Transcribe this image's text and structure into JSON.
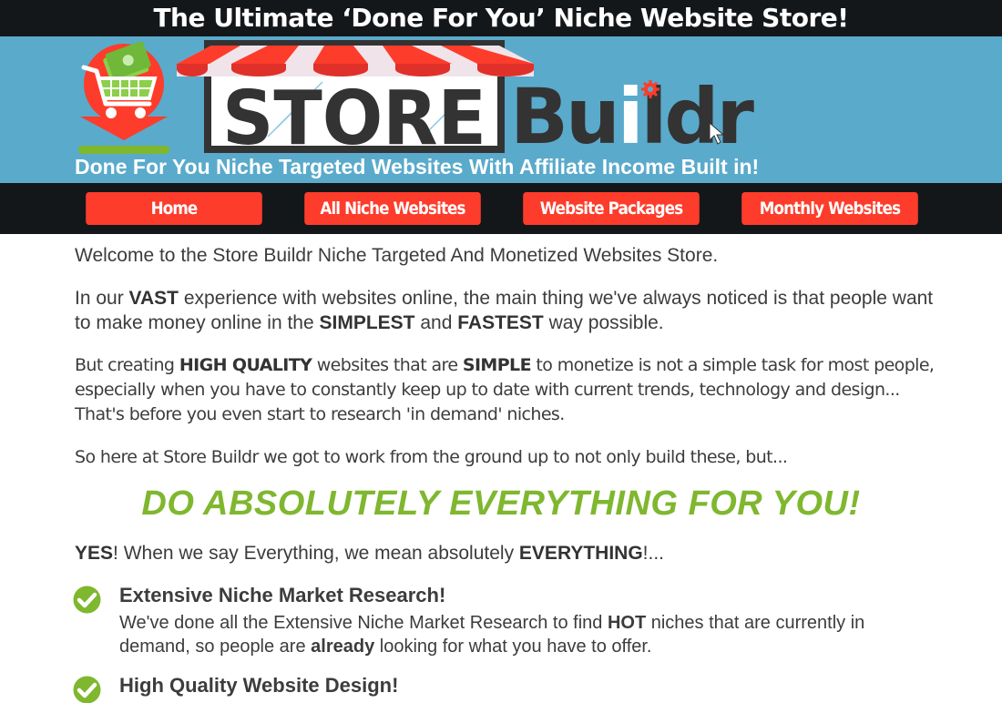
{
  "banner": {
    "title": "The Ultimate ‘Done For You’ Niche Website Store!"
  },
  "header": {
    "logo_store": "STORE",
    "logo_buildr_pre": "Bu",
    "logo_buildr_i": "i",
    "logo_buildr_post": "ldr",
    "tagline": "Done For You Niche Targeted Websites With Affiliate Income Built in!",
    "colors": {
      "header_bg": "#5aaacb",
      "awning_red": "#fd3c2b",
      "logo_dark": "#333333",
      "accent_green": "#7fb72f"
    }
  },
  "nav": {
    "items": [
      {
        "label": "Home"
      },
      {
        "label": "All Niche Websites"
      },
      {
        "label": "Website Packages"
      },
      {
        "label": "Monthly Websites"
      }
    ]
  },
  "content": {
    "welcome": "Welcome to the Store Buildr Niche Targeted And Monetized Websites Store.",
    "vast": {
      "t1": "In our ",
      "b1": "VAST",
      "t2": " experience with websites online, the main thing we've always noticed is that people want to make money online in the ",
      "b2": "SIMPLEST",
      "t3": " and ",
      "b3": "FASTEST",
      "t4": " way possible."
    },
    "quality": {
      "t1": "But creating ",
      "b1": "HIGH QUALITY",
      "t2": " websites that are ",
      "b2": "SIMPLE",
      "t3": " to monetize is not a simple task for most people, especially when you have to constantly keep up to date with current trends, technology and design... That's before you even start to research 'in demand' niches."
    },
    "sohere": "So here at Store Buildr we got to work from the ground up to not only build these, but...",
    "headline": "DO ABSOLUTELY EVERYTHING FOR YOU!",
    "yes": {
      "b1": "YES",
      "t1": "! When we say Everything, we mean absolutely ",
      "b2": "EVERYTHING",
      "t2": "!..."
    },
    "features": [
      {
        "icon": "check-circle-icon",
        "title": "Extensive Niche Market Research!",
        "desc_t1": "We've done all the Extensive Niche Market Research to find ",
        "desc_b1": "HOT",
        "desc_t2": " niches that are currently in demand, so people are ",
        "desc_b2": "already",
        "desc_t3": " looking for what you have to offer."
      },
      {
        "icon": "check-circle-icon",
        "title": "High Quality Website Design!"
      }
    ]
  }
}
